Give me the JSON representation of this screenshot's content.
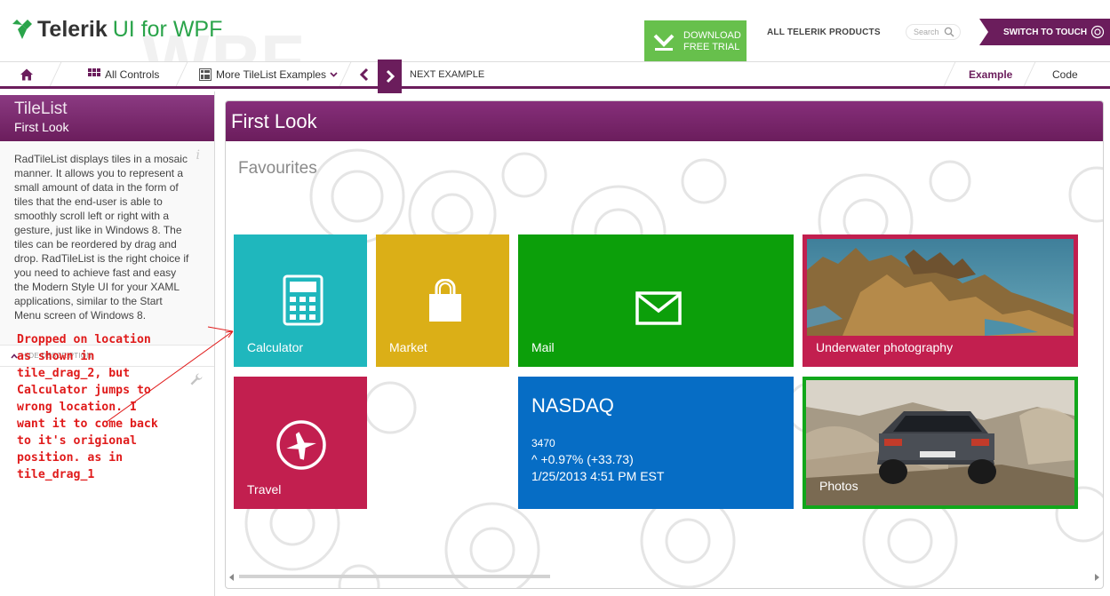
{
  "header": {
    "watermark": "WPF",
    "logo_brand": "Telerik",
    "logo_product": "UI for WPF",
    "download_line1": "DOWNLOAD",
    "download_line2": "FREE TRIAL",
    "all_products": "ALL TELERIK PRODUCTS",
    "search_placeholder": "Search",
    "switch_touch": "SWITCH TO TOUCH"
  },
  "toolbar": {
    "all_controls": "All Controls",
    "more_examples": "More TileList Examples",
    "next_example": "NEXT EXAMPLE",
    "tab_example": "Example",
    "tab_code": "Code"
  },
  "left_panel": {
    "title": "TileList",
    "subtitle": "First Look",
    "description": "RadTileList displays tiles in a mosaic manner. It allows you to represent a small amount of data in the form of tiles that the end-user is able to smoothly scroll left or right with a gesture, just like in Windows 8. The tiles can be reordered by drag and drop. RadTileList is the right choice if you need to achieve fast and easy the Modern Style UI for your XAML applications, similar to the Start Menu screen of Windows 8.",
    "hide_description": "HIDE DESCRIPTION",
    "annotation": "Dropped on location\nas shown in\ntile_drag_2, but\nCalculator jumps to\nwrong location. I\nwant it to come back\nto it's origional\nposition. as in\ntile_drag_1"
  },
  "main": {
    "header": "First Look",
    "group_title": "Favourites",
    "tiles": {
      "calculator": {
        "label": "Calculator",
        "color": "#1fb7bd",
        "icon": "calculator-icon"
      },
      "market": {
        "label": "Market",
        "color": "#dbaf17",
        "icon": "shopping-bag-icon"
      },
      "mail": {
        "label": "Mail",
        "color": "#0c9f0a",
        "icon": "mail-icon"
      },
      "underwater": {
        "label": "Underwater photography",
        "color": "#c21f4f"
      },
      "travel": {
        "label": "Travel",
        "color": "#c21f4f",
        "icon": "airplane-icon"
      },
      "nasdaq": {
        "title": "NASDAQ",
        "value": "3470",
        "change": "^ +0.97% (+33.73)",
        "timestamp": "1/25/2013 4:51 PM EST",
        "color": "#066dc5"
      },
      "photos": {
        "label": "Photos",
        "border_color": "#11a71b"
      }
    }
  },
  "colors": {
    "accent": "#6b1d5c",
    "download_green": "#67c04c",
    "annotation_red": "#e01b1b"
  }
}
